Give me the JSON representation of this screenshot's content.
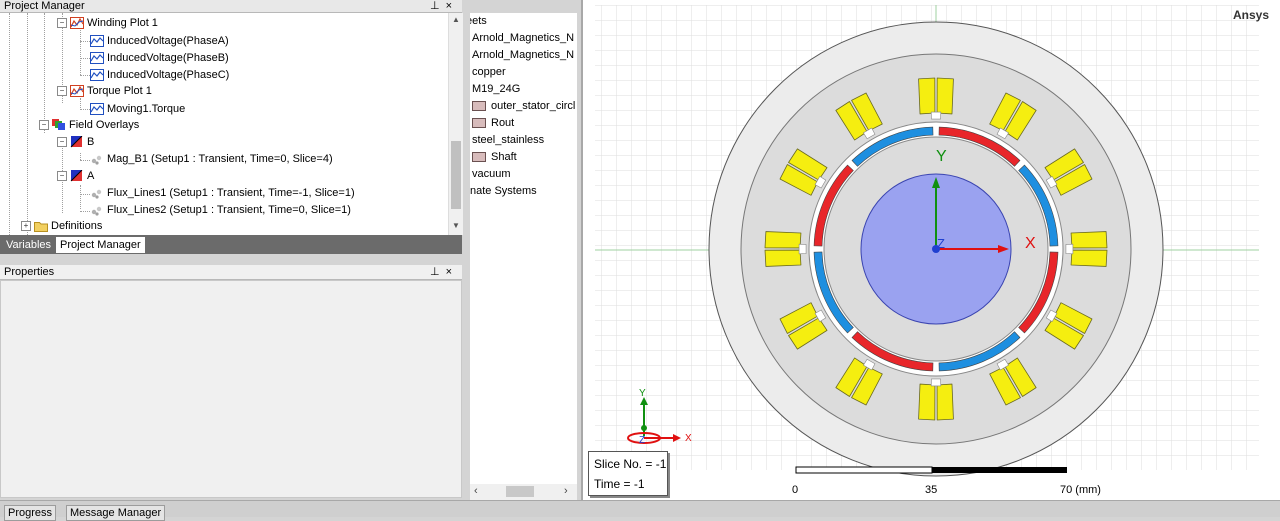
{
  "project_manager": {
    "title": "Project Manager",
    "pin": "⊥",
    "close": "×",
    "tree": {
      "winding_plot": "Winding Plot 1",
      "induced_a": "InducedVoltage(PhaseA)",
      "induced_b": "InducedVoltage(PhaseB)",
      "induced_c": "InducedVoltage(PhaseC)",
      "torque_plot": "Torque Plot 1",
      "moving_torque": "Moving1.Torque",
      "field_overlays": "Field Overlays",
      "b_group": "B",
      "mag_b1": "Mag_B1 (Setup1 : Transient, Time=0, Slice=4)",
      "a_group": "A",
      "flux_lines1": "Flux_Lines1 (Setup1 : Transient, Time=-1, Slice=1)",
      "flux_lines2": "Flux_Lines2 (Setup1 : Transient, Time=0, Slice=1)",
      "definitions": "Definitions"
    },
    "tabs": {
      "variables": "Variables",
      "project_manager": "Project Manager"
    }
  },
  "properties": {
    "title": "Properties",
    "pin": "⊥",
    "close": "×"
  },
  "model_tree": {
    "items": {
      "sheets": "eets",
      "arnold1": "Arnold_Magnetics_N",
      "arnold2": "Arnold_Magnetics_N",
      "copper": "copper",
      "m19": "M19_24G",
      "outer_stator": "outer_stator_circl",
      "rout": "Rout",
      "steel": "steel_stainless",
      "shaft": "Shaft",
      "vacuum": "vacuum",
      "coord": "nate Systems"
    }
  },
  "viewport": {
    "brand": "Ansys",
    "axis_x": "X",
    "axis_y": "Y",
    "axis_z": "Z",
    "triad_x": "X",
    "triad_y": "Y",
    "triad_z": "Z",
    "slice_label": "Slice No. = -1",
    "time_label": "Time = -1",
    "scale_0": "0",
    "scale_35": "35",
    "scale_70": "70 (mm)"
  },
  "bottom": {
    "progress": "Progress",
    "message_manager": "Message Manager"
  },
  "colors": {
    "magnet_red": "#e8262a",
    "magnet_blue": "#1e8fe0",
    "coil_yellow": "#f5ee10",
    "shaft": "#9aa2f0",
    "stator": "#dcdcdc"
  }
}
